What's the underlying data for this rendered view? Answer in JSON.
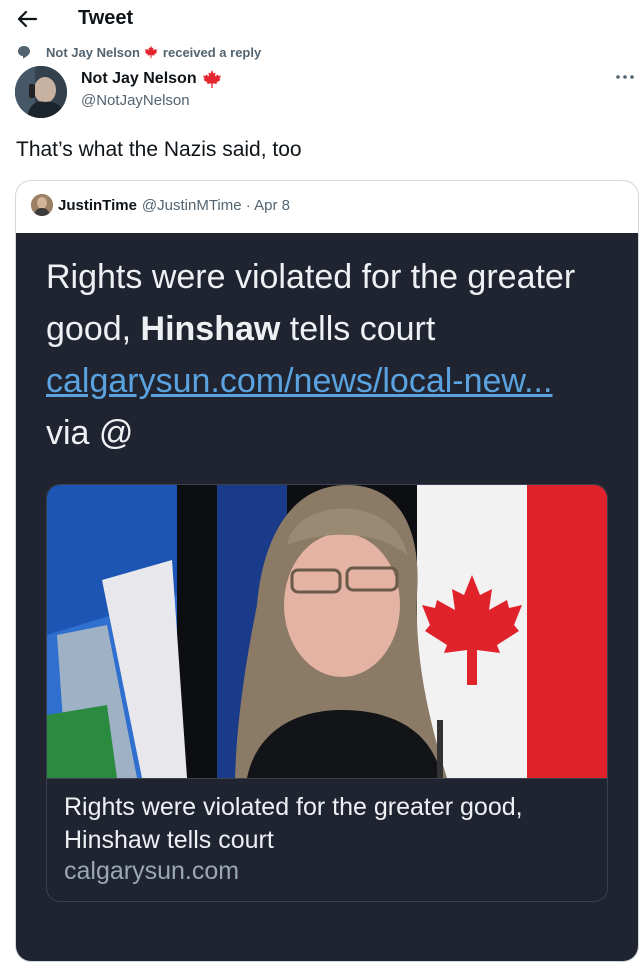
{
  "header": {
    "title": "Tweet"
  },
  "context": {
    "user": "Not Jay Nelson",
    "action": "received a reply"
  },
  "author": {
    "name": "Not Jay Nelson",
    "handle": "@NotJayNelson"
  },
  "tweet": {
    "text": "That’s what the Nazis said, too"
  },
  "quoted": {
    "name": "JustinTime",
    "handle": "@JustinMTime",
    "date": "Apr 8",
    "headline_pre": "Rights were violated for the greater good, ",
    "headline_bold": "Hinshaw",
    "headline_post": " tells court",
    "link": "calgarysun.com/news/local-new...",
    "via": "via @",
    "card": {
      "title": "Rights were violated for the greater good, Hinshaw tells court",
      "domain": "calgarysun.com"
    }
  },
  "colors": {
    "dark_bg": "#1f2430",
    "link": "#5aa3e0",
    "canada_red": "#e3262f"
  }
}
